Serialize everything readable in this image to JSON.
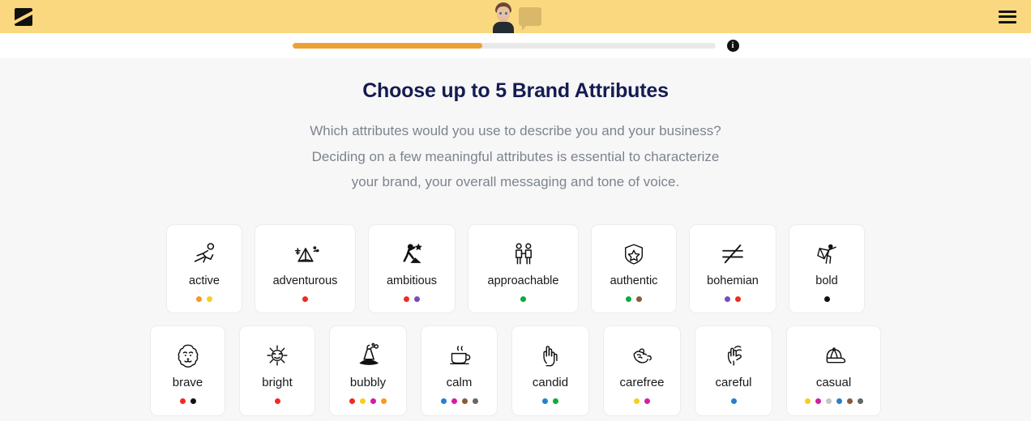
{
  "header": {
    "logo_name": "brand-logo",
    "avatar_name": "user-avatar",
    "speech_bubble_name": "speech-bubble",
    "menu_label": "☰",
    "background_color": "#fad87f"
  },
  "progress": {
    "percent": 45,
    "fill_color": "#eda135",
    "track_color": "#e9e9e9",
    "info_label": "i"
  },
  "main": {
    "title": "Choose up to 5 Brand Attributes",
    "subtitle_line1": "Which attributes would you use to describe you and your business?",
    "subtitle_line2": "Deciding on a few meaningful attributes is essential to characterize",
    "subtitle_line3": "your brand, your overall messaging and tone of voice.",
    "max_selectable": 5
  },
  "attributes": {
    "row1": [
      {
        "label": "active",
        "icon": "running-person-icon",
        "width": 94,
        "dots": [
          "#f79a20",
          "#f7cf1e"
        ]
      },
      {
        "label": "adventurous",
        "icon": "tent-camping-icon",
        "width": 125,
        "dots": [
          "#ef2b23"
        ]
      },
      {
        "label": "ambitious",
        "icon": "climber-star-icon",
        "width": 108,
        "dots": [
          "#ef2b23",
          "#7b4bbd"
        ]
      },
      {
        "label": "approachable",
        "icon": "handshake-people-icon",
        "width": 137,
        "dots": [
          "#0cab3e"
        ]
      },
      {
        "label": "authentic",
        "icon": "shield-star-icon",
        "width": 106,
        "dots": [
          "#0cab3e",
          "#8a5a3b"
        ]
      },
      {
        "label": "bohemian",
        "icon": "not-equal-icon",
        "width": 108,
        "dots": [
          "#7b4bbd",
          "#ef2b23"
        ]
      },
      {
        "label": "bold",
        "icon": "hero-cape-icon",
        "width": 94,
        "dots": [
          "#111111"
        ]
      }
    ],
    "row2": [
      {
        "label": "brave",
        "icon": "lion-head-icon",
        "width": 93,
        "dots": [
          "#ef2b23",
          "#111111"
        ]
      },
      {
        "label": "bright",
        "icon": "sun-smile-icon",
        "width": 94,
        "dots": [
          "#ef2b23"
        ]
      },
      {
        "label": "bubbly",
        "icon": "volcano-icon",
        "width": 96,
        "dots": [
          "#ef2b23",
          "#f7cf1e",
          "#d61ca8",
          "#f79a20"
        ]
      },
      {
        "label": "calm",
        "icon": "coffee-cup-icon",
        "width": 95,
        "dots": [
          "#2a7fc9",
          "#d61ca8",
          "#8a5a3b",
          "#666666"
        ]
      },
      {
        "label": "candid",
        "icon": "hand-peace-icon",
        "width": 96,
        "dots": [
          "#2a7fc9",
          "#0cab3e"
        ]
      },
      {
        "label": "carefree",
        "icon": "hand-shaka-icon",
        "width": 96,
        "dots": [
          "#f7cf1e",
          "#d61ca8"
        ]
      },
      {
        "label": "careful",
        "icon": "hand-quiet-icon",
        "width": 96,
        "dots": [
          "#2a7fc9"
        ]
      },
      {
        "label": "casual",
        "icon": "baseball-cap-icon",
        "width": 117,
        "dots": [
          "#f7cf1e",
          "#d61ca8",
          "#c4c4c4",
          "#2a7fc9",
          "#8a5a3b",
          "#666666"
        ]
      }
    ]
  }
}
